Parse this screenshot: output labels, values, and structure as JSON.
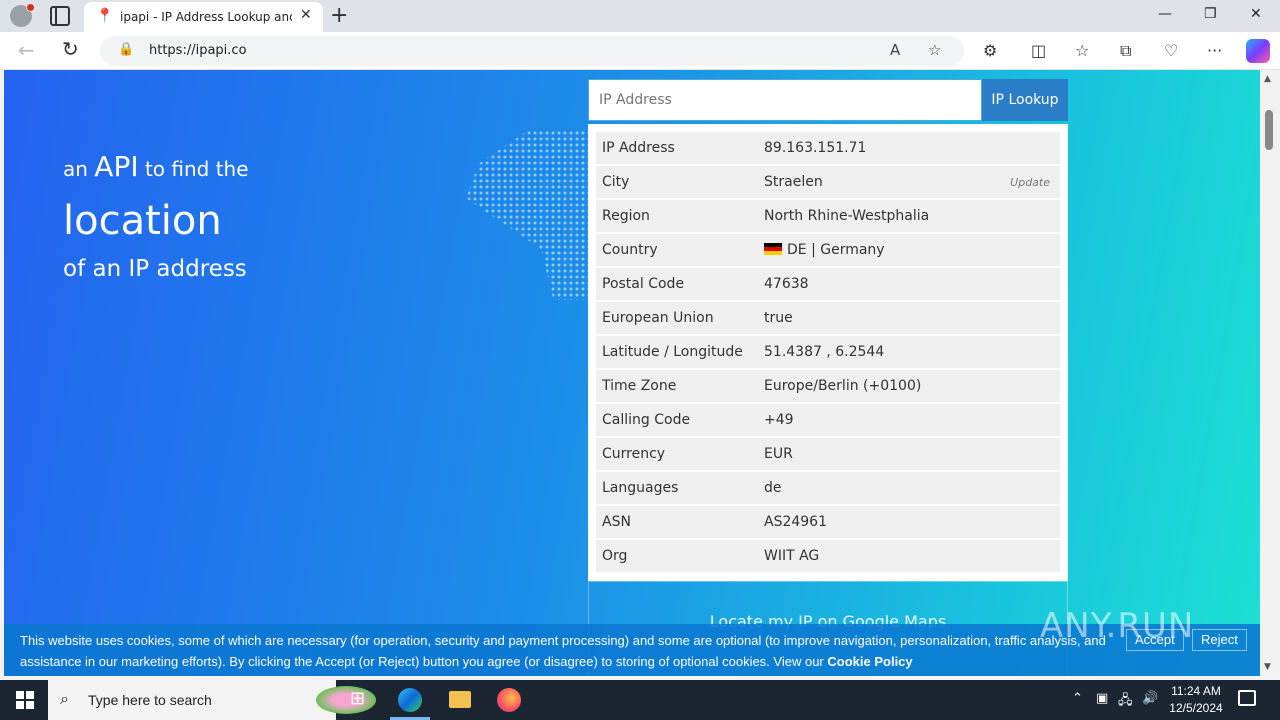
{
  "browser": {
    "tab_title": "ipapi - IP Address Lookup and Ge",
    "url": "https://ipapi.co"
  },
  "hero": {
    "line1_pre": "an",
    "line1_big": "API",
    "line1_post": "to find the",
    "line2": "location",
    "line3": "of an IP address"
  },
  "lookup": {
    "placeholder": "IP Address",
    "button_label": "IP Lookup"
  },
  "results": [
    {
      "key": "IP Address",
      "value": "89.163.151.71"
    },
    {
      "key": "City",
      "value": "Straelen",
      "action": "Update"
    },
    {
      "key": "Region",
      "value": "North Rhine-Westphalia"
    },
    {
      "key": "Country",
      "value": "DE | Germany"
    },
    {
      "key": "Postal Code",
      "value": "47638"
    },
    {
      "key": "European Union",
      "value": "true"
    },
    {
      "key": "Latitude / Longitude",
      "value": "51.4387 , 6.2544"
    },
    {
      "key": "Time Zone",
      "value": "Europe/Berlin (+0100)"
    },
    {
      "key": "Calling Code",
      "value": "+49"
    },
    {
      "key": "Currency",
      "value": "EUR"
    },
    {
      "key": "Languages",
      "value": "de"
    },
    {
      "key": "ASN",
      "value": "AS24961"
    },
    {
      "key": "Org",
      "value": "WIIT AG"
    }
  ],
  "maps_link": "Locate my IP on Google Maps",
  "cookie": {
    "text": "This website uses cookies, some of which are necessary (for operation, security and payment processing) and some are optional (to improve navigation, personalization, traffic analysis, and assistance in our marketing efforts). By clicking the Accept (or Reject) button you agree (or disagree) to storing of optional cookies. View our",
    "link": "Cookie Policy",
    "accept": "Accept",
    "reject": "Reject"
  },
  "watermark": "ANY.RUN",
  "taskbar": {
    "search_placeholder": "Type here to search",
    "time": "11:24 AM",
    "date": "12/5/2024"
  }
}
